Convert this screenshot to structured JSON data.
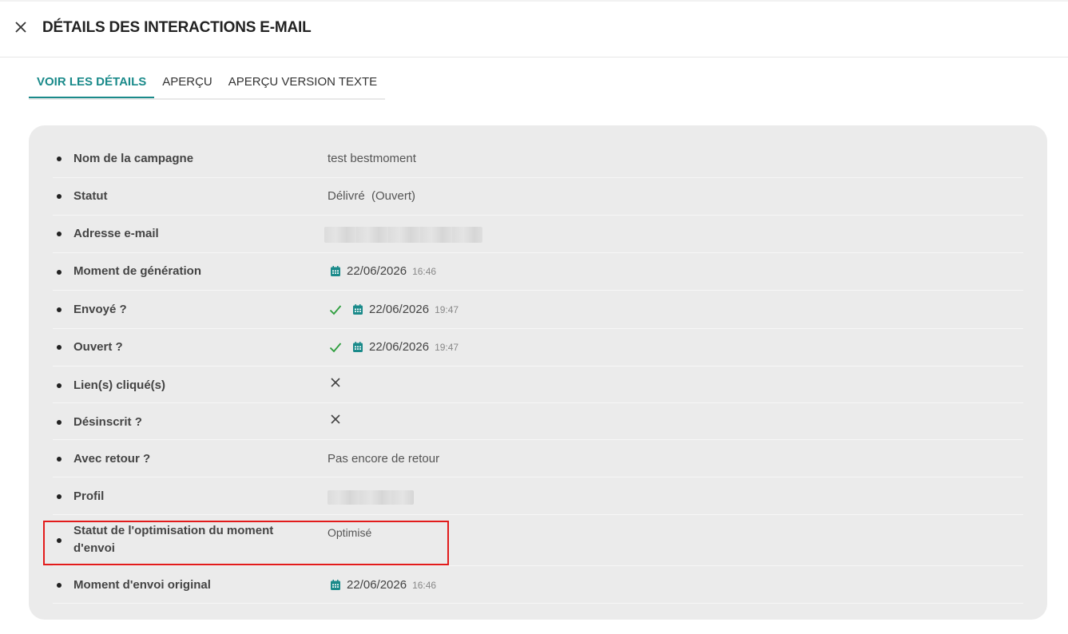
{
  "header": {
    "title": "DÉTAILS DES INTERACTIONS E-MAIL"
  },
  "tabs": [
    {
      "label": "VOIR LES DÉTAILS",
      "active": true
    },
    {
      "label": "APERÇU",
      "active": false
    },
    {
      "label": "APERÇU VERSION TEXTE",
      "active": false
    }
  ],
  "colors": {
    "accent": "#1a8a8a",
    "check": "#2e9e3e",
    "highlight_border": "#e21b1b",
    "panel_bg": "#ebebeb"
  },
  "details": {
    "campaign_name": {
      "label": "Nom de la campagne",
      "value": "test bestmoment"
    },
    "status": {
      "label": "Statut",
      "value": "Délivré  (Ouvert)"
    },
    "email": {
      "label": "Adresse e-mail"
    },
    "generation": {
      "label": "Moment de génération",
      "date": "22/06/2026",
      "time": "16:46"
    },
    "sent": {
      "label": "Envoyé ?",
      "date": "22/06/2026",
      "time": "19:47"
    },
    "opened": {
      "label": "Ouvert ?",
      "date": "22/06/2026",
      "time": "19:47"
    },
    "clicked": {
      "label": "Lien(s) cliqué(s)"
    },
    "unsubscribed": {
      "label": "Désinscrit ?"
    },
    "reply": {
      "label": "Avec retour ?",
      "value": "Pas encore de retour"
    },
    "profile": {
      "label": "Profil"
    },
    "send_time_optimization": {
      "label": "Statut de l'optimisation du moment d'envoi",
      "value": "Optimisé"
    },
    "original_send_time": {
      "label": "Moment d'envoi original",
      "date": "22/06/2026",
      "time": "16:46"
    }
  }
}
